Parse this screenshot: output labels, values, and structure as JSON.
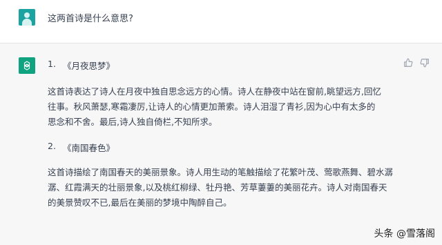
{
  "user": {
    "message": "这两首诗是什么意思?"
  },
  "assistant": {
    "sections": [
      {
        "number": "1.",
        "title": "《月夜思梦》",
        "lines": [
          "这首诗表达了诗人在月夜中独自思念远方的心情。诗人在静夜中站在窗前,眺望远方,回忆",
          "往事。秋风萧瑟,寒霜凄厉,让诗人的心情更加萧索。诗人泪湿了青衫,因为心中有太多的",
          "思念和不舍。最后,诗人独自倚栏,不知所求。"
        ]
      },
      {
        "number": "2.",
        "title": "《南国春色》",
        "lines": [
          "这首诗描绘了南国春天的美丽景象。诗人用生动的笔触描绘了花繁叶茂、莺歌燕舞、碧水潺",
          "潺、红霞满天的壮丽景象,以及桃红柳绿、牡丹艳、芳草萋萋的美丽花卉。诗人对南国春天",
          "的美景赞叹不已,最后在美丽的梦境中陶醉自己。"
        ]
      }
    ],
    "icons": {
      "bot": "openai-logo-icon",
      "like": "thumbs-up-icon",
      "dislike": "thumbs-down-icon"
    }
  },
  "watermark": {
    "text": "头条 @雪落阁"
  },
  "colors": {
    "bot_avatar": "#10a37f",
    "user_avatar": "#1aa3a0",
    "assistant_bg": "#f7f7f8"
  }
}
